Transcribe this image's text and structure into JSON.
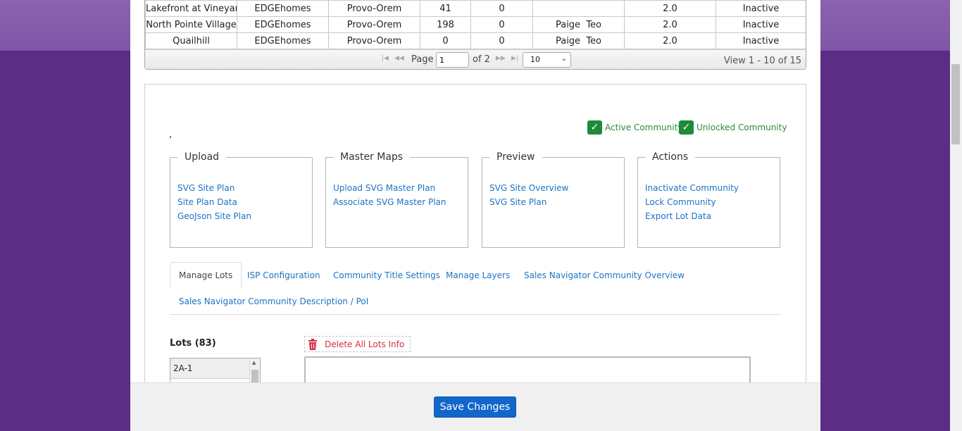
{
  "grid": {
    "rows": [
      [
        "Lakefront at Vineyard",
        "EDGEhomes",
        "Provo-Orem",
        "41",
        "0",
        "",
        "2.0",
        "Inactive"
      ],
      [
        "North Pointe Village",
        "EDGEhomes",
        "Provo-Orem",
        "198",
        "0",
        "Paige  Teo",
        "2.0",
        "Inactive"
      ],
      [
        "Quailhill",
        "EDGEhomes",
        "Provo-Orem",
        "0",
        "0",
        "Paige  Teo",
        "2.0",
        "Inactive"
      ]
    ],
    "pager": {
      "page_label": "Page",
      "page_value": "1",
      "of_label": "of 2",
      "page_size": "10",
      "view_text": "View 1 - 10 of 15"
    }
  },
  "checks": {
    "active": "Active Community",
    "unlocked": "Unlocked Community"
  },
  "comma": ",",
  "groups": {
    "upload": {
      "legend": "Upload",
      "links": [
        "SVG Site Plan",
        "Site Plan Data",
        "GeoJson Site Plan"
      ]
    },
    "master": {
      "legend": "Master Maps",
      "links": [
        "Upload SVG Master Plan",
        "Associate SVG Master Plan"
      ]
    },
    "preview": {
      "legend": "Preview",
      "links": [
        "SVG Site Overview",
        "SVG Site Plan"
      ]
    },
    "actions": {
      "legend": "Actions",
      "links": [
        "Inactivate Community",
        "Lock Community",
        "Export Lot Data"
      ]
    }
  },
  "tabs": [
    "Manage Lots",
    "ISP Configuration",
    "Community Title Settings",
    "Manage Layers",
    "Sales Navigator Community Overview",
    "Sales Navigator Community Description / PoI"
  ],
  "lots": {
    "title": "Lots (83)",
    "items": [
      "2A-1"
    ]
  },
  "delete_label": "Delete All Lots Info",
  "save_label": "Save Changes"
}
